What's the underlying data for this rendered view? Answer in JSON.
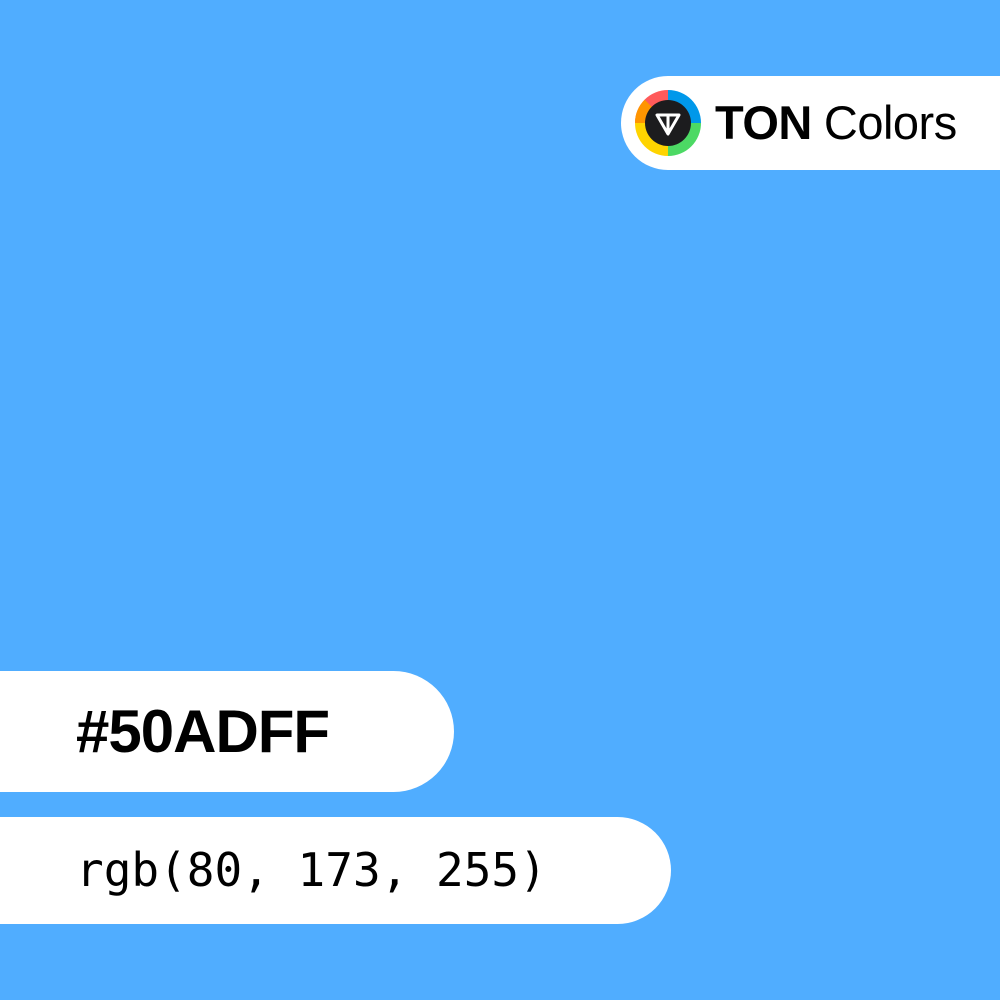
{
  "swatch": {
    "color": "#50ADFF"
  },
  "brand": {
    "name_strong": "TON",
    "name_light": "Colors",
    "logo_icon": "ton-diamond-color-wheel-icon",
    "logo_colors": [
      "#FF5A5A",
      "#0098EA",
      "#4CD964",
      "#FFD400",
      "#FF9500",
      "#1C1C1E"
    ]
  },
  "color_info": {
    "hex": "#50ADFF",
    "rgb": "rgb(80, 173, 255)"
  }
}
